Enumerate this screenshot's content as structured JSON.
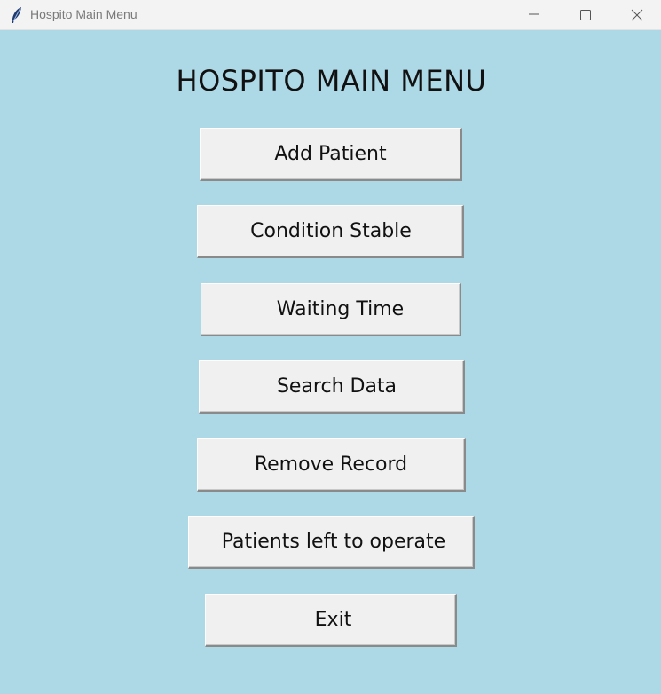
{
  "window": {
    "title": "Hospito Main Menu"
  },
  "heading": "HOSPITO MAIN MENU",
  "buttons": {
    "add_patient": "Add Patient",
    "condition_stable": "Condition Stable",
    "waiting_time": "Waiting Time",
    "search_data": "Search Data",
    "remove_record": "Remove Record",
    "patients_left": "Patients left to operate",
    "exit": "Exit"
  },
  "colors": {
    "background": "#add8e6",
    "button_face": "#f0f0f0",
    "titlebar": "#f3f3f3"
  },
  "icons": {
    "app": "feather-icon",
    "minimize": "minimize-icon",
    "maximize": "maximize-icon",
    "close": "close-icon"
  }
}
